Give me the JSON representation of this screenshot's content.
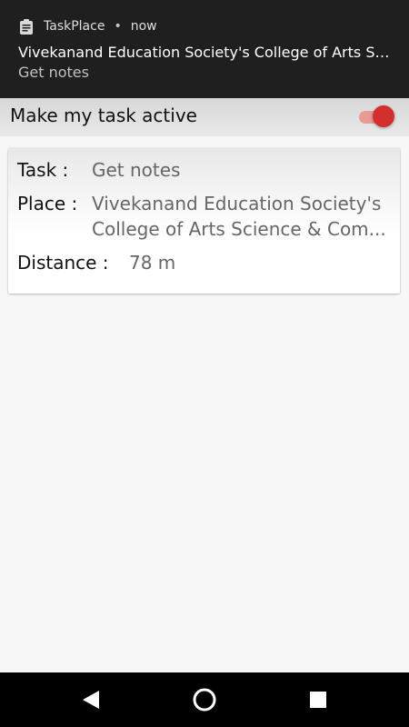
{
  "notification": {
    "app_name": "TaskPlace",
    "separator": "•",
    "time": "now",
    "title": "Vivekanand Education Society's College of Arts Scien..",
    "text": "Get notes",
    "icon": "clipboard-icon"
  },
  "toggle": {
    "label": "Make my task active",
    "state": true,
    "accent": "#d32f2f"
  },
  "card": {
    "task_label": "Task :",
    "task_value": "Get notes",
    "place_label": "Place :",
    "place_line1": "Vivekanand Education Society's",
    "place_line2": "College of Arts Science & Com...",
    "distance_label": "Distance :",
    "distance_value": "78 m"
  },
  "navbar": {
    "back_icon": "back-icon",
    "home_icon": "home-icon",
    "recents_icon": "recents-icon"
  }
}
